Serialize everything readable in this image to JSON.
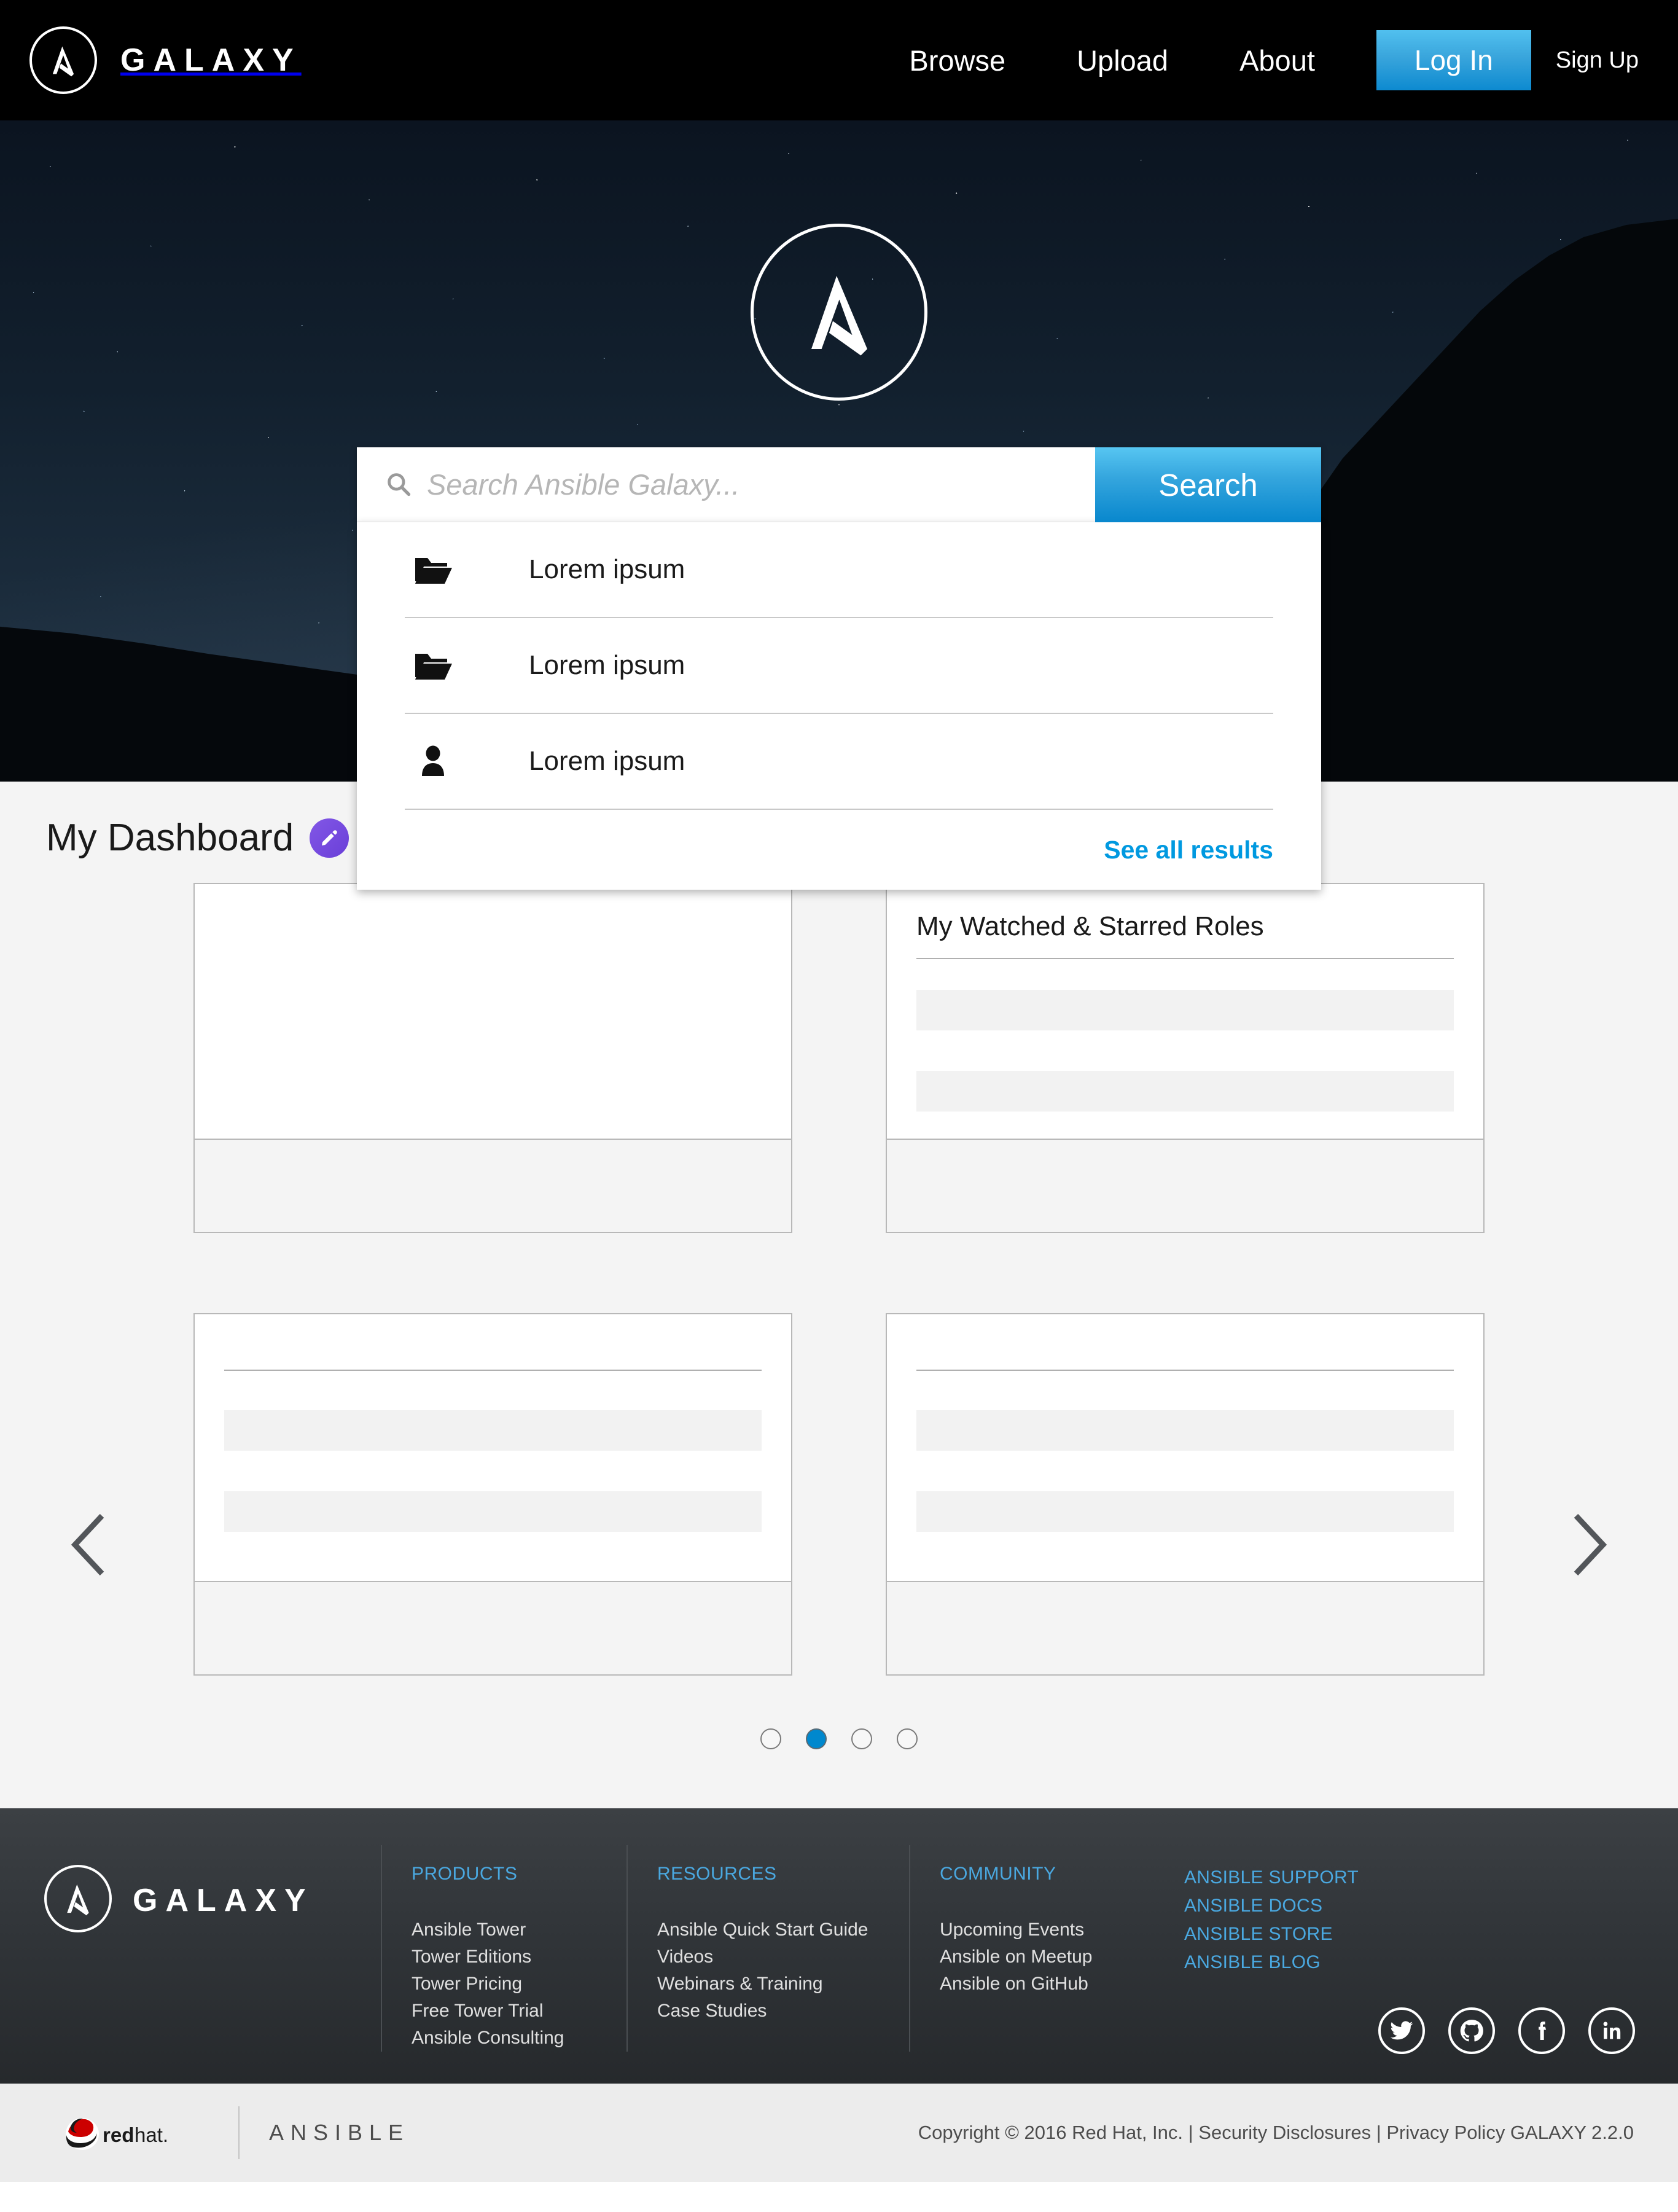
{
  "brand": {
    "name": "GALAXY",
    "logo_icon": "ansible-a-logo"
  },
  "nav": {
    "links": [
      {
        "label": "Browse"
      },
      {
        "label": "Upload"
      },
      {
        "label": "About"
      }
    ],
    "login_label": "Log In",
    "signup_label": "Sign Up",
    "accent_color": "#0088ce"
  },
  "hero": {
    "logo_icon": "ansible-a-logo"
  },
  "search": {
    "placeholder": "Search Ansible Galaxy...",
    "value": "",
    "button_label": "Search",
    "icon": "search-icon",
    "results": [
      {
        "icon": "folder-open-icon",
        "label": "Lorem ipsum"
      },
      {
        "icon": "folder-open-icon",
        "label": "Lorem ipsum"
      },
      {
        "icon": "user-icon",
        "label": "Lorem ipsum"
      }
    ],
    "see_all_label": "See all results"
  },
  "dashboard": {
    "title": "My Dashboard",
    "edit_icon": "pencil-icon",
    "edit_color": "#7048e0",
    "cards": [
      {
        "title": ""
      },
      {
        "title": "My Watched & Starred Roles"
      },
      {
        "title": ""
      },
      {
        "title": ""
      }
    ],
    "prev_icon": "chevron-left-icon",
    "next_icon": "chevron-right-icon",
    "dots": {
      "count": 4,
      "active_index": 1,
      "active_color": "#0088ce"
    }
  },
  "footer": {
    "logo_word": "GALAXY",
    "columns": [
      {
        "title": "PRODUCTS",
        "links": [
          "Ansible Tower",
          "Tower Editions",
          "Tower Pricing",
          "Free Tower Trial",
          "Ansible Consulting"
        ]
      },
      {
        "title": "RESOURCES",
        "links": [
          "Ansible Quick Start Guide",
          "Videos",
          "Webinars & Training",
          "Case Studies"
        ]
      },
      {
        "title": "COMMUNITY",
        "links": [
          "Upcoming Events",
          "Ansible on Meetup",
          "Ansible on GitHub"
        ]
      }
    ],
    "highlight_links": [
      "ANSIBLE SUPPORT",
      "ANSIBLE DOCS",
      "ANSIBLE STORE",
      "ANSIBLE BLOG"
    ],
    "socials": [
      {
        "icon": "twitter-icon"
      },
      {
        "icon": "github-icon"
      },
      {
        "icon": "facebook-icon"
      },
      {
        "icon": "linkedin-icon"
      }
    ],
    "link_color": "#4aa8e0"
  },
  "bottombar": {
    "redhat_label": "redhat.",
    "ansible_label": "ANSIBLE",
    "copyright": "Copyright © 2016 Red Hat, Inc. | Security Disclosures | Privacy Policy GALAXY 2.2.0"
  }
}
